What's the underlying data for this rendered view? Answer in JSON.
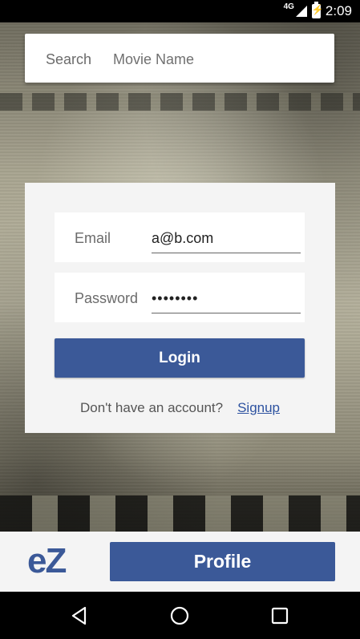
{
  "status_bar": {
    "network": "4G",
    "time": "2:09"
  },
  "search": {
    "label": "Search",
    "placeholder": "Movie Name"
  },
  "login": {
    "email_label": "Email",
    "email_value": "a@b.com",
    "password_label": "Password",
    "password_value": "••••••••",
    "login_label": "Login",
    "signup_prompt": "Don't have an account?",
    "signup_link": "Signup"
  },
  "bottom_bar": {
    "logo_text": "eZ",
    "profile_label": "Profile"
  },
  "colors": {
    "brand": "#3b5998",
    "card_bg": "#f4f4f4",
    "link": "#2d52a0"
  },
  "icons": {
    "back": "back-triangle-icon",
    "home": "home-circle-icon",
    "recents": "recents-square-icon",
    "signal": "signal-icon",
    "battery": "battery-charging-icon"
  }
}
